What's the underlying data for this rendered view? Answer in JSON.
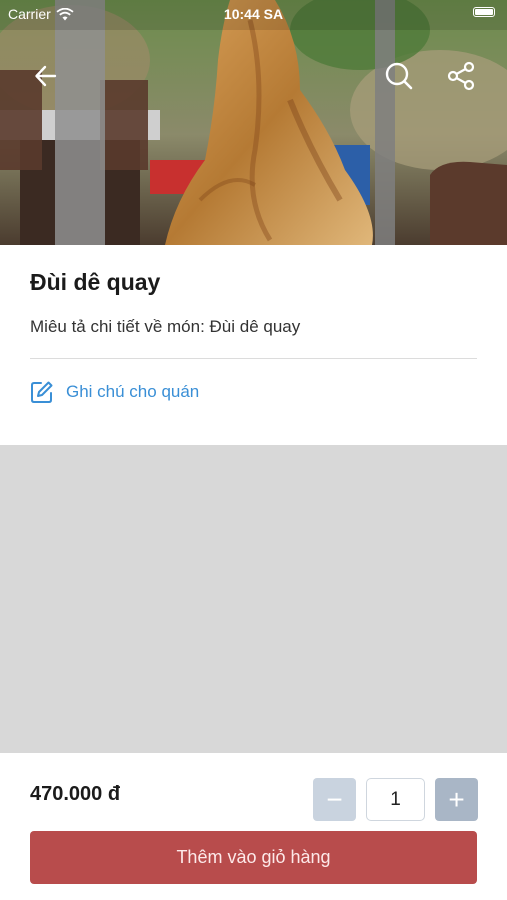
{
  "status_bar": {
    "carrier": "Carrier",
    "time": "10:44 SA"
  },
  "nav": {
    "back_icon": "arrow-left-icon",
    "search_icon": "search-icon",
    "share_icon": "share-icon"
  },
  "dish": {
    "title": "Đùi dê quay",
    "description": "Miêu tả chi tiết về món: Đùi dê quay",
    "note_link": "Ghi chú cho quán",
    "note_icon": "edit-icon"
  },
  "order": {
    "price": "470.000 đ",
    "quantity": "1",
    "minus_label": "−",
    "plus_label": "+",
    "add_to_cart": "Thêm vào giỏ hàng"
  },
  "colors": {
    "accent_blue": "#3a8fd6",
    "cart_button": "#b84c4c",
    "qty_button": "#a9b6c6",
    "gray_area": "#d8d8d8"
  }
}
